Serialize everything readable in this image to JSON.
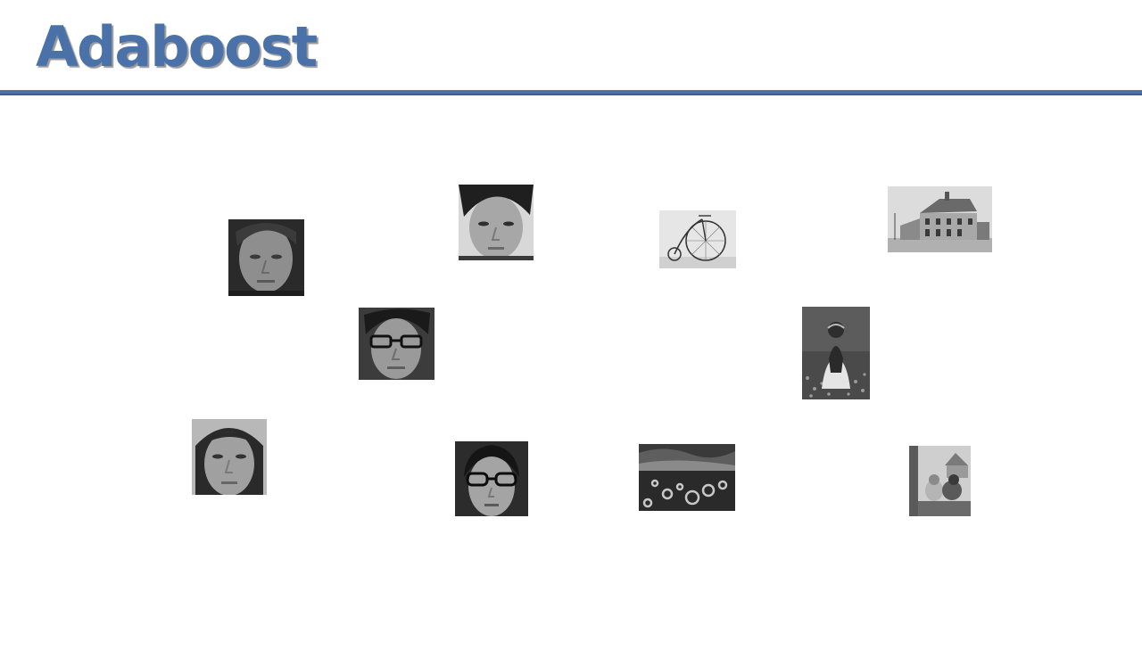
{
  "slide": {
    "title": "Adaboost"
  },
  "face_images": [
    {
      "icon": "face-photo-icon"
    },
    {
      "icon": "face-photo-icon"
    },
    {
      "icon": "face-photo-icon"
    },
    {
      "icon": "face-photo-icon"
    },
    {
      "icon": "face-photo-icon"
    }
  ],
  "nonface_images": [
    {
      "icon": "bicycle-photo-icon"
    },
    {
      "icon": "house-photo-icon"
    },
    {
      "icon": "girl-in-field-photo-icon"
    },
    {
      "icon": "sunflowers-photo-icon"
    },
    {
      "icon": "dogs-photo-icon"
    }
  ],
  "colors": {
    "title": "#4a72a8",
    "rule": "#4a72a8"
  }
}
